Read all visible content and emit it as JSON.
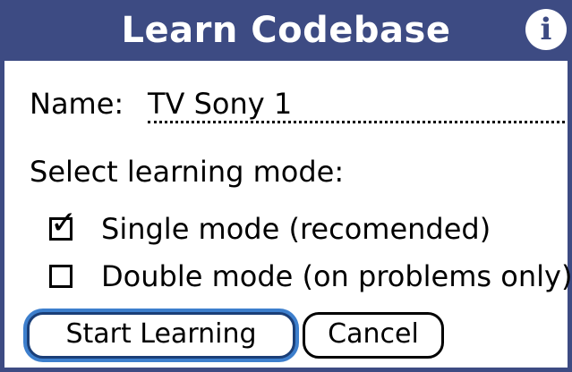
{
  "dialog": {
    "title": "Learn Codebase",
    "info_icon": "info-icon",
    "colors": {
      "titlebar": "#3d4b83",
      "focus_ring": "#3d7fcd"
    }
  },
  "name_row": {
    "label": "Name:",
    "value": "TV Sony 1"
  },
  "mode_section": {
    "label": "Select learning mode:",
    "options": [
      {
        "label": "Single mode (recomended)",
        "checked": true
      },
      {
        "label": "Double mode (on problems only)",
        "checked": false
      }
    ]
  },
  "buttons": {
    "start_label": "Start Learning",
    "cancel_label": "Cancel"
  }
}
